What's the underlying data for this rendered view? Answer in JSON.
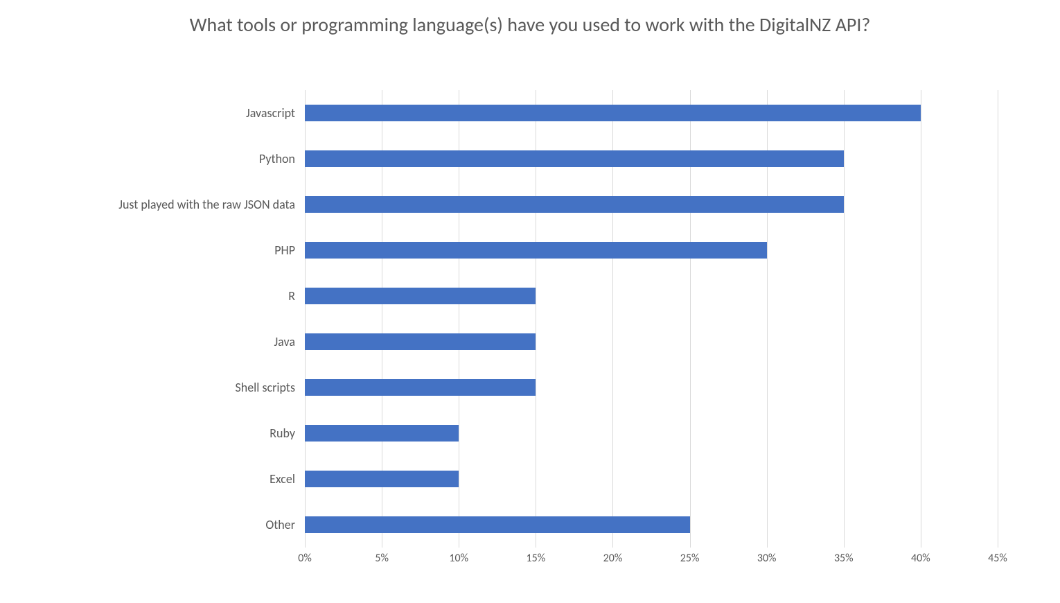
{
  "chart_data": {
    "type": "bar",
    "orientation": "horizontal",
    "title": "What tools or programming language(s) have you used to work with the DigitalNZ API?",
    "xlabel": "",
    "ylabel": "",
    "x_unit": "percent",
    "xlim": [
      0,
      45
    ],
    "x_tick_step": 5,
    "x_ticks": [
      0,
      5,
      10,
      15,
      20,
      25,
      30,
      35,
      40,
      45
    ],
    "x_tick_labels": [
      "0%",
      "5%",
      "10%",
      "15%",
      "20%",
      "25%",
      "30%",
      "35%",
      "40%",
      "45%"
    ],
    "categories": [
      "Javascript",
      "Python",
      "Just played with the raw JSON data",
      "PHP",
      "R",
      "Java",
      "Shell scripts",
      "Ruby",
      "Excel",
      "Other"
    ],
    "values": [
      40,
      35,
      35,
      30,
      15,
      15,
      15,
      10,
      10,
      25
    ],
    "bar_color": "#4472c4",
    "gridline_color": "#d9d9d9"
  }
}
